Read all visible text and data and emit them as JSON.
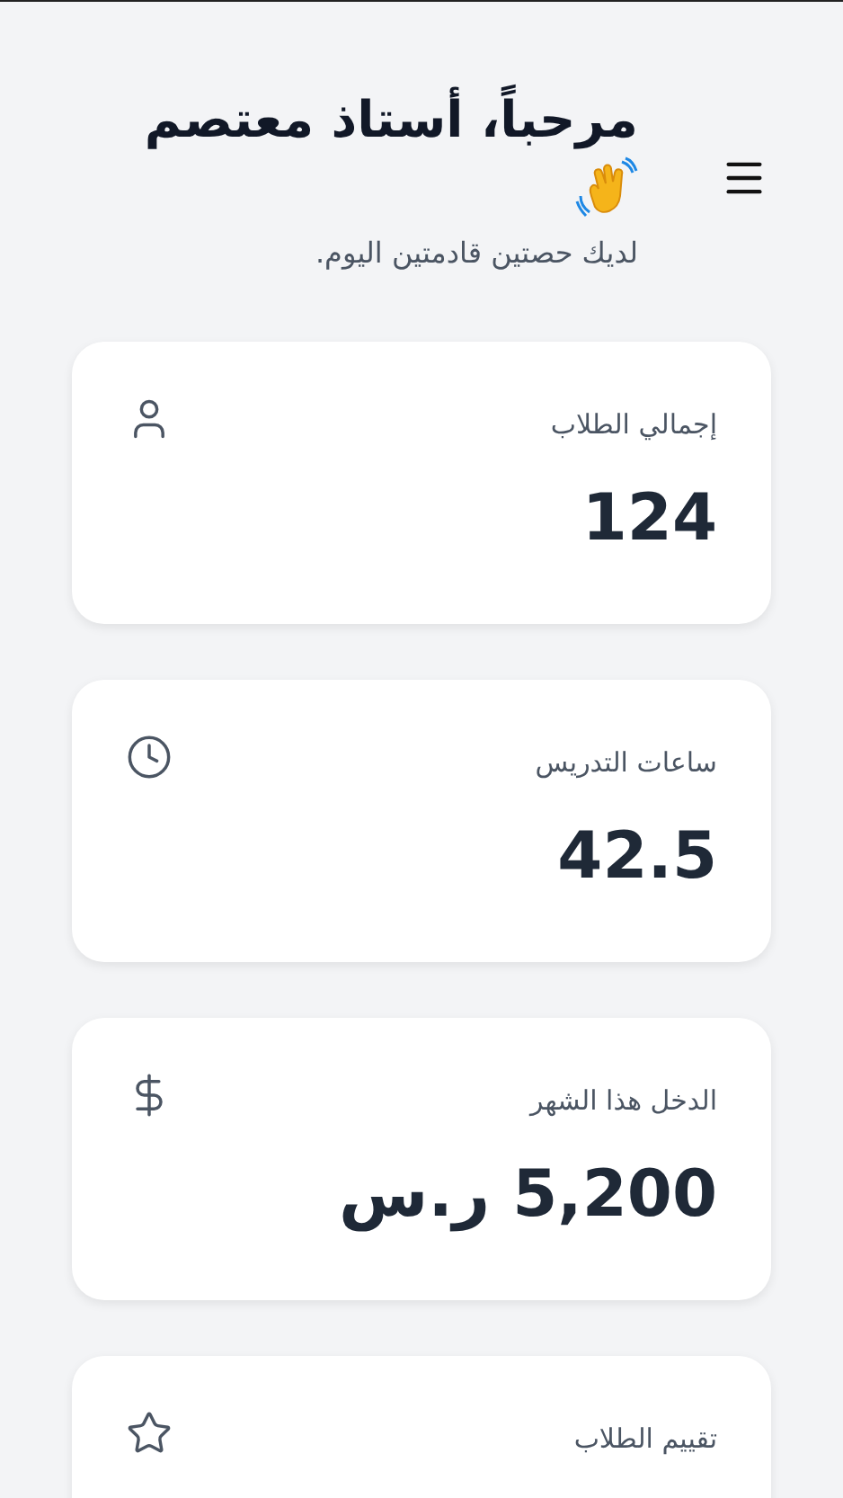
{
  "header": {
    "title": "مرحباً، أستاذ معتصم",
    "subtitle": "لديك حصتين قادمتين اليوم."
  },
  "stats": [
    {
      "label": "إجمالي الطلاب",
      "value": "124",
      "kind": "user"
    },
    {
      "label": "ساعات التدريس",
      "value": "42.5",
      "kind": "clock"
    },
    {
      "label": "الدخل هذا الشهر",
      "value": "5,200 ر.س",
      "kind": "dollar"
    },
    {
      "label": "تقييم الطلاب",
      "kind": "star"
    }
  ]
}
